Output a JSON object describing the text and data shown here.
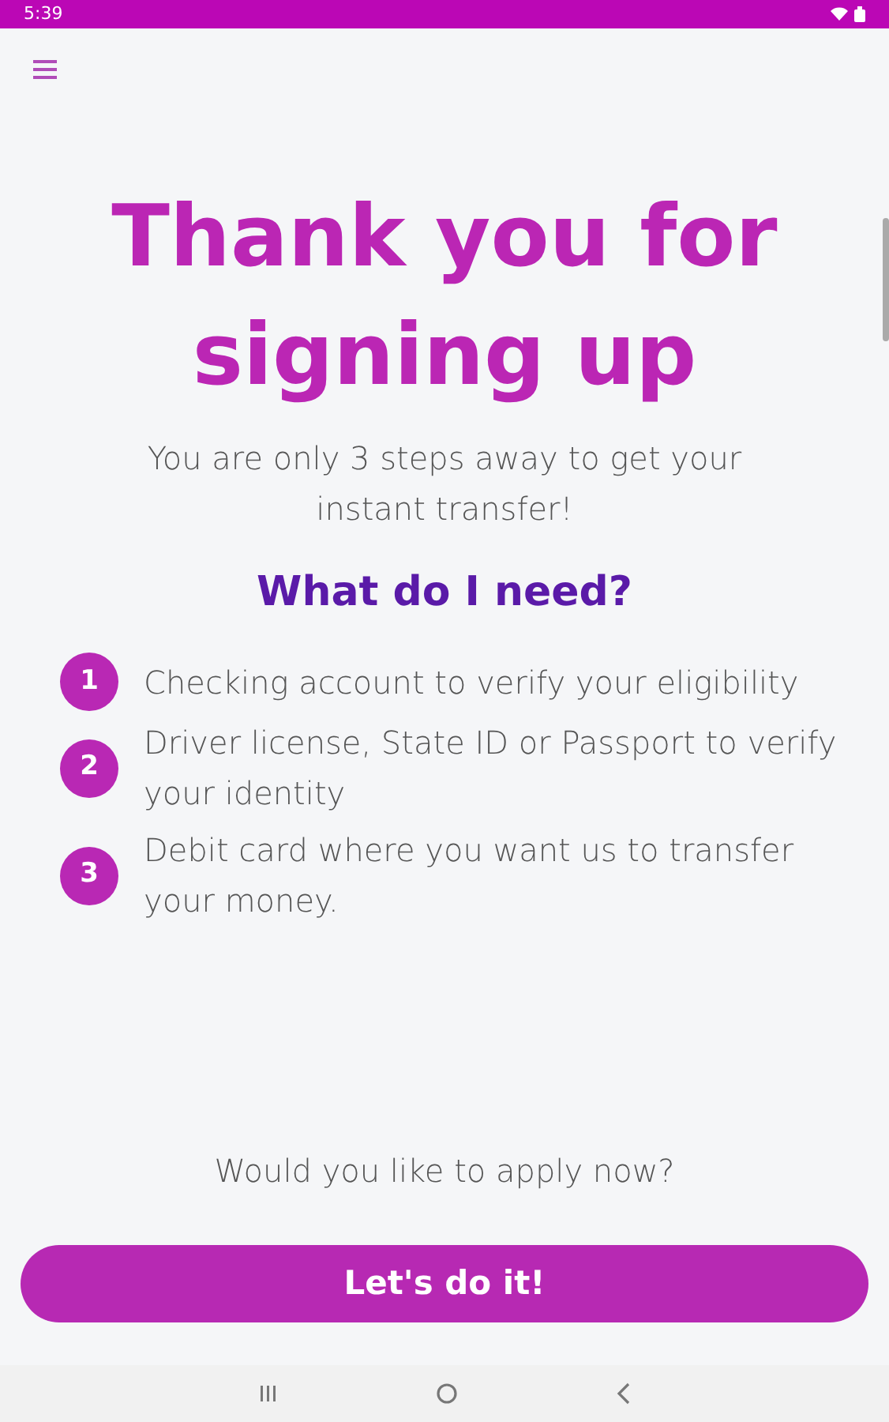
{
  "status_bar": {
    "time": "5:39"
  },
  "title": "Thank you for signing up",
  "subtitle": "You are only 3 steps away to get your instant transfer!",
  "heading": "What do I need?",
  "steps": [
    {
      "number": "1",
      "text": "Checking account to verify your eligibility"
    },
    {
      "number": "2",
      "text": "Driver license, State ID or Passport to verify your identity"
    },
    {
      "number": "3",
      "text": "Debit card where you want us to transfer your money."
    }
  ],
  "question": "Would you like to apply now?",
  "button": "Let's do it!"
}
